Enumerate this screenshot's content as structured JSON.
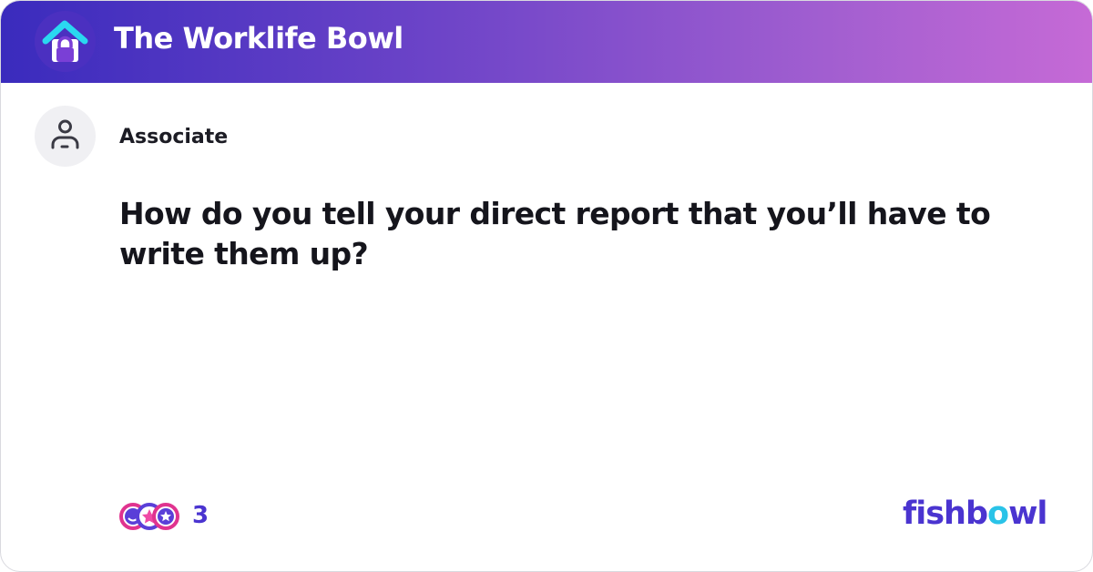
{
  "header": {
    "bowl_icon": "house-lock-icon",
    "bowl_name": "The Worklife Bowl"
  },
  "post": {
    "author_icon": "person-icon",
    "author": "Associate",
    "question": "How do you tell your direct report that you’ll have to write them up?"
  },
  "footer": {
    "reaction_icons": [
      "smile-reaction-icon",
      "star-reaction-icon",
      "star-reaction-icon"
    ],
    "reaction_count": "3",
    "brand_parts": [
      "fishb",
      "o",
      "wl"
    ]
  },
  "colors": {
    "header_gradient": [
      "#3a2bbd",
      "#c66ad6"
    ],
    "accent": "#4a34d0",
    "brand_o": "#2ac3e8"
  }
}
